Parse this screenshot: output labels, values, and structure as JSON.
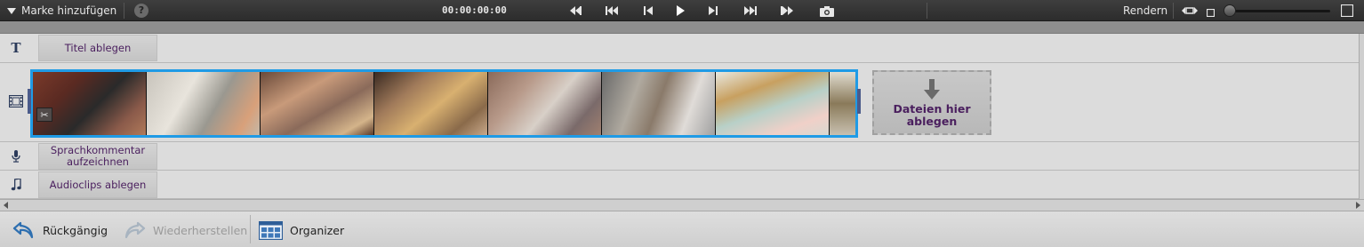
{
  "topbar": {
    "marker_label": "Marke hinzufügen",
    "help_glyph": "?",
    "timecode": "00:00:00:00",
    "render_label": "Rendern"
  },
  "tracks": {
    "title_drop": "Titel ablegen",
    "voice_drop": "Sprachkommentar aufzeichnen",
    "audio_drop": "Audioclips ablegen"
  },
  "drop_target": {
    "label": "Dateien hier ablegen"
  },
  "bottombar": {
    "undo_label": "Rückgängig",
    "redo_label": "Wiederherstellen",
    "organizer_label": "Organizer"
  },
  "colors": {
    "accent": "#1f9be6",
    "label_text": "#4a1f5e",
    "topbar_bg": "#333333"
  },
  "icons": [
    "dropdown-triangle-icon",
    "help-icon",
    "goto-in-icon",
    "skip-back-icon",
    "step-back-icon",
    "play-icon",
    "step-forward-icon",
    "skip-forward-icon",
    "goto-out-icon",
    "camera-icon",
    "fit-zoom-icon",
    "zoom-out-icon",
    "zoom-in-icon",
    "text-track-icon",
    "film-track-icon",
    "microphone-icon",
    "music-note-icon",
    "scissors-icon",
    "down-arrow-icon",
    "undo-icon",
    "redo-icon",
    "organizer-icon"
  ]
}
